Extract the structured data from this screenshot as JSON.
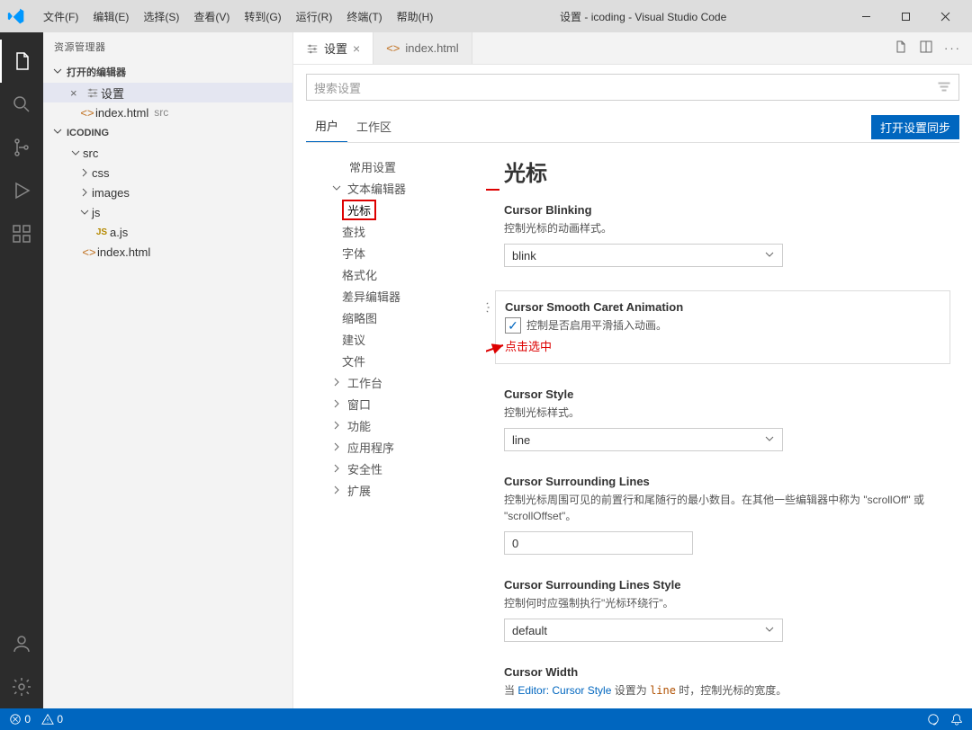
{
  "titlebar": {
    "menu": [
      "文件(F)",
      "编辑(E)",
      "选择(S)",
      "查看(V)",
      "转到(G)",
      "运行(R)",
      "终端(T)",
      "帮助(H)"
    ],
    "title": "设置 - icoding - Visual Studio Code"
  },
  "sidebar": {
    "header": "资源管理器",
    "open_editors": "打开的编辑器",
    "open_items": [
      {
        "label": "设置",
        "close": "×"
      },
      {
        "label": "index.html",
        "note": "src"
      }
    ],
    "project": "ICODING",
    "tree": {
      "src": "src",
      "css": "css",
      "images": "images",
      "js": "js",
      "ajs": "a.js",
      "indexhtml": "index.html"
    }
  },
  "tabs": {
    "settings": "设置",
    "index": "index.html"
  },
  "settings": {
    "search_placeholder": "搜索设置",
    "scope_user": "用户",
    "scope_workspace": "工作区",
    "sync": "打开设置同步",
    "toc": {
      "common": "常用设置",
      "text_editor": "文本编辑器",
      "cursor": "光标",
      "find": "查找",
      "font": "字体",
      "format": "格式化",
      "diff": "差异编辑器",
      "minimap": "缩略图",
      "suggest": "建议",
      "file": "文件",
      "workbench": "工作台",
      "window": "窗口",
      "feature": "功能",
      "app": "应用程序",
      "security": "安全性",
      "ext": "扩展"
    },
    "content": {
      "heading": "光标",
      "blinking": {
        "title": "Cursor Blinking",
        "desc": "控制光标的动画样式。",
        "value": "blink"
      },
      "smooth": {
        "title": "Cursor Smooth Caret Animation",
        "desc": "控制是否启用平滑插入动画。",
        "annotation": "点击选中"
      },
      "style": {
        "title": "Cursor Style",
        "desc": "控制光标样式。",
        "value": "line"
      },
      "surrounding": {
        "title": "Cursor Surrounding Lines",
        "desc": "控制光标周围可见的前置行和尾随行的最小数目。在其他一些编辑器中称为 \"scrollOff\" 或 \"scrollOffset\"。",
        "value": "0"
      },
      "surrounding_style": {
        "title": "Cursor Surrounding Lines Style",
        "desc": "控制何时应强制执行\"光标环绕行\"。",
        "value": "default"
      },
      "width": {
        "title": "Cursor Width",
        "desc_prefix": "当 ",
        "desc_link": "Editor: Cursor Style",
        "desc_mid": " 设置为 ",
        "desc_val": "line",
        "desc_suffix": " 时，控制光标的宽度。"
      }
    }
  },
  "statusbar": {
    "errors": "0",
    "warnings": "0"
  }
}
